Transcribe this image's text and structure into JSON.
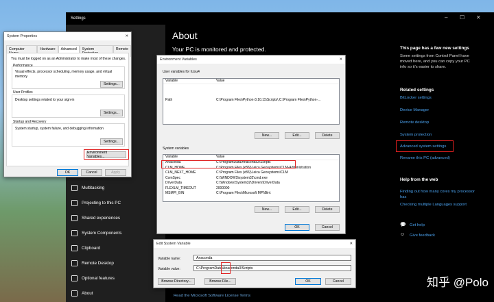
{
  "settings": {
    "title": "Settings",
    "about": "About",
    "protected": "Your PC is monitored and protected.",
    "nav": [
      "Multitasking",
      "Projecting to this PC",
      "Shared experiences",
      "System Components",
      "Clipboard",
      "Remote Desktop",
      "Optional features",
      "About"
    ],
    "new_settings_head": "This page has a few new settings",
    "new_settings_text": "Some settings from Control Panel have moved here, and you can copy your PC info so it's easier to share.",
    "related_head": "Related settings",
    "related": [
      "BitLocker settings",
      "Device Manager",
      "Remote desktop",
      "System protection",
      "Advanced system settings",
      "Rename this PC (advanced)"
    ],
    "help_head": "Help from the web",
    "help": [
      "Finding out how many cores my processor has",
      "Checking multiple Languages support"
    ],
    "get_help": "Get help",
    "feedback": "Give feedback",
    "bottom_link": "Read the Microsoft Software License Terms"
  },
  "sysprops": {
    "title": "System Properties",
    "tabs": [
      "Computer Name",
      "Hardware",
      "Advanced",
      "System Protection",
      "Remote"
    ],
    "admin_note": "You must be logged on as an Administrator to make most of these changes.",
    "perf_title": "Performance",
    "perf_text": "Visual effects, processor scheduling, memory usage, and virtual memory",
    "profiles_title": "User Profiles",
    "profiles_text": "Desktop settings related to your sign-in",
    "startup_title": "Startup and Recovery",
    "startup_text": "System startup, system failure, and debugging information",
    "settings_btn": "Settings...",
    "env_btn": "Environment Variables...",
    "ok": "OK",
    "cancel": "Cancel",
    "apply": "Apply"
  },
  "envvars": {
    "title": "Environment Variables",
    "user_label": "User variables for hzxu4",
    "col_var": "Variable",
    "col_val": "Value",
    "user_rows": [
      [
        "Path",
        "C:\\Program Files\\Python-3.10.11\\Scripts\\;C:\\Program Files\\Python-..."
      ]
    ],
    "sys_label": "System variables",
    "sys_rows": [
      [
        "Anaconda",
        "C:\\ProgramData\\Anaconda3\\Scripts"
      ],
      [
        "CLM_HOME",
        "C:\\Program Files (x86)\\Leica Geosystems\\CLM-Administration"
      ],
      [
        "CLM_NEXT_HOME",
        "C:\\Program Files (x86)\\Leica Geosystems\\CLM"
      ],
      [
        "ComSpec",
        "C:\\WINDOWS\\system32\\cmd.exe"
      ],
      [
        "DriverData",
        "C:\\Windows\\System32\\Drivers\\DriverData"
      ],
      [
        "FLEXLM_TIMEOUT",
        "2000000"
      ],
      [
        "MSMPI_BIN",
        "C:\\Program Files\\Microsoft MPI\\Bin\\"
      ]
    ],
    "new": "New...",
    "edit": "Edit...",
    "delete": "Delete",
    "ok": "OK",
    "cancel": "Cancel"
  },
  "editvar": {
    "title": "Edit System Variable",
    "name_label": "Variable name:",
    "value_label": "Variable value:",
    "name": "Anaconda",
    "value": "C:\\ProgramData\\Anaconda3\\Scripts",
    "browse_dir": "Browse Directory...",
    "browse_file": "Browse File...",
    "ok": "OK",
    "cancel": "Cancel"
  },
  "watermark": "知乎 @Polo"
}
